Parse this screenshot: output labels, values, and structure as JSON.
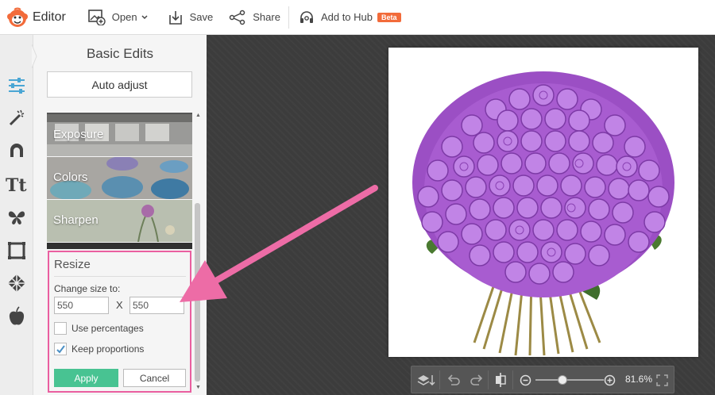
{
  "app": {
    "title": "Editor"
  },
  "toolbar": {
    "open_label": "Open",
    "save_label": "Save",
    "share_label": "Share",
    "hub_label": "Add to Hub",
    "beta_label": "Beta"
  },
  "rail": {
    "icons": [
      "sliders-icon",
      "magic-wand-icon",
      "face-icon",
      "text-icon",
      "butterfly-icon",
      "frame-icon",
      "texture-icon",
      "apple-icon"
    ]
  },
  "panel": {
    "title": "Basic Edits",
    "auto_adjust": "Auto adjust",
    "tiles": [
      {
        "label": "Exposure"
      },
      {
        "label": "Colors"
      },
      {
        "label": "Sharpen"
      }
    ]
  },
  "resize": {
    "title": "Resize",
    "change_size_label": "Change size to:",
    "width_value": "550",
    "x_label": "X",
    "height_value": "550",
    "use_percentages_label": "Use percentages",
    "use_percentages_checked": false,
    "keep_proportions_label": "Keep proportions",
    "keep_proportions_checked": true,
    "apply_label": "Apply",
    "cancel_label": "Cancel"
  },
  "zoom": {
    "value": "81.6%",
    "level": 0.4
  },
  "colors": {
    "accent": "#48c392",
    "highlight": "#ea5fa0",
    "beta": "#f26b3a",
    "canvas": "#3c3c3c"
  }
}
